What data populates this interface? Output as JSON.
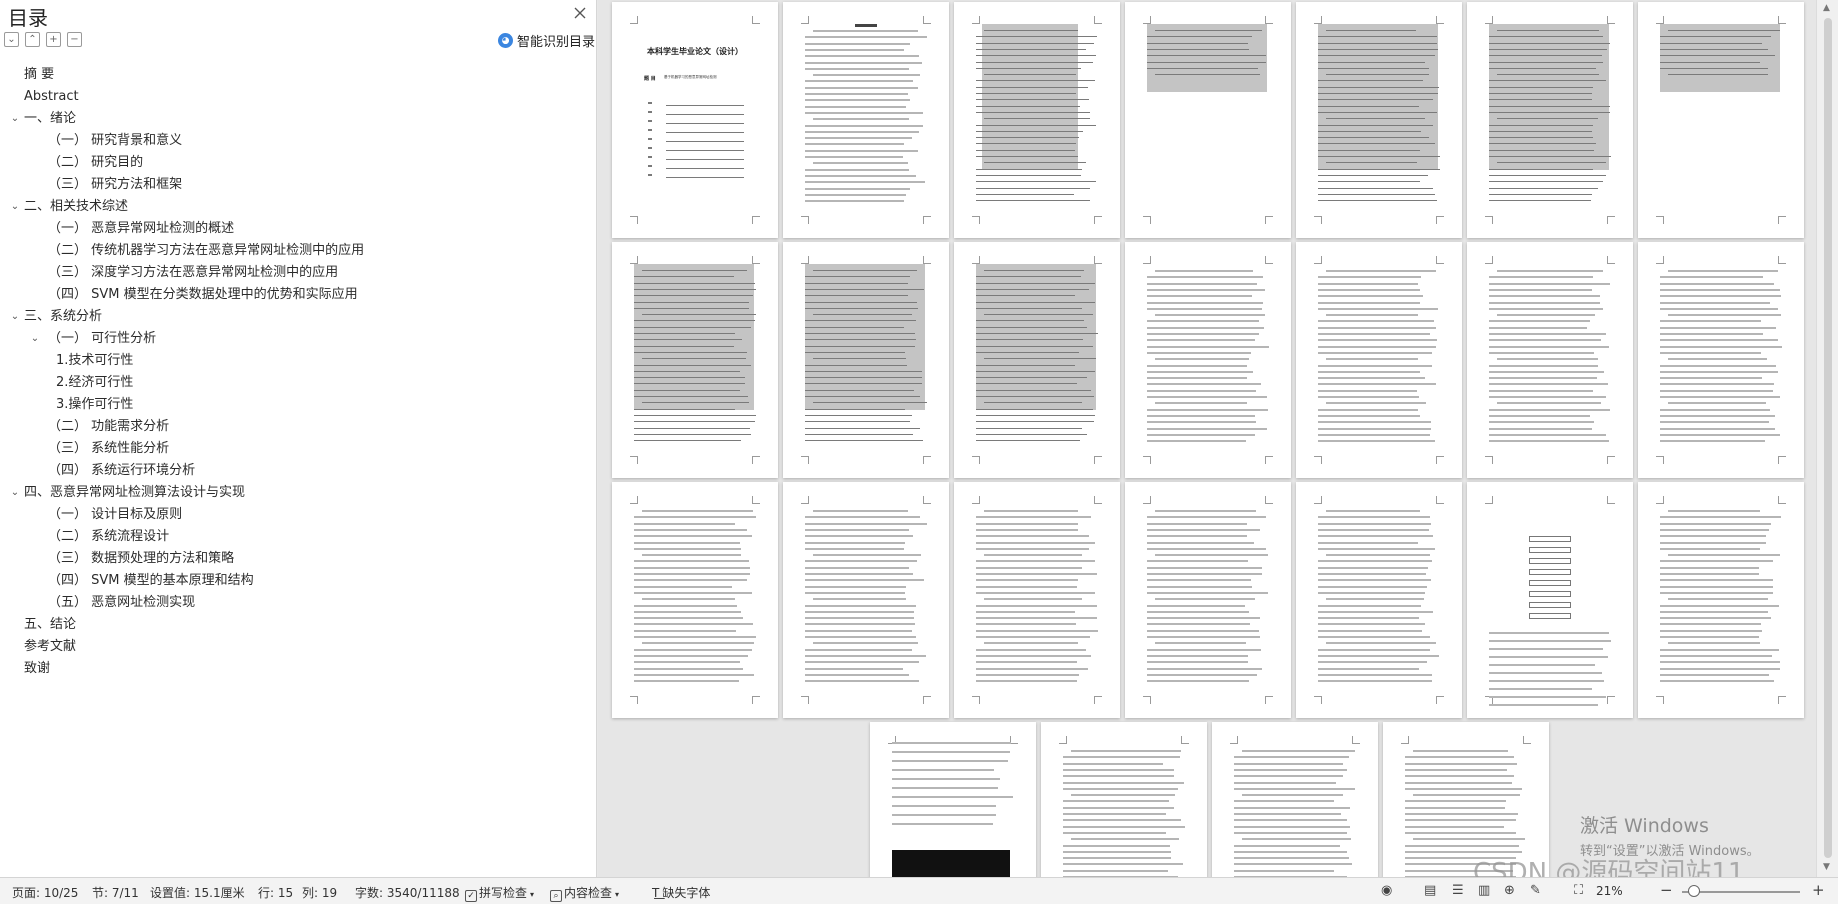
{
  "toc": {
    "title": "目录",
    "smart_toc_label": "智能识别目录",
    "items": [
      {
        "label": "摘 要",
        "level": 0,
        "caret": ""
      },
      {
        "label": "Abstract",
        "level": 0,
        "caret": ""
      },
      {
        "label": "一、绪论",
        "level": 0,
        "caret": "expanded"
      },
      {
        "label": "（一） 研究背景和意义",
        "level": 1,
        "caret": ""
      },
      {
        "label": "（二） 研究目的",
        "level": 1,
        "caret": ""
      },
      {
        "label": "（三） 研究方法和框架",
        "level": 1,
        "caret": ""
      },
      {
        "label": "二、相关技术综述",
        "level": 0,
        "caret": "expanded"
      },
      {
        "label": "（一） 恶意异常网址检测的概述",
        "level": 1,
        "caret": ""
      },
      {
        "label": "（二） 传统机器学习方法在恶意异常网址检测中的应用",
        "level": 1,
        "caret": ""
      },
      {
        "label": "（三） 深度学习方法在恶意异常网址检测中的应用",
        "level": 1,
        "caret": ""
      },
      {
        "label": "（四） SVM 模型在分类数据处理中的优势和实际应用",
        "level": 1,
        "caret": ""
      },
      {
        "label": "三、系统分析",
        "level": 0,
        "caret": "expanded"
      },
      {
        "label": "（一） 可行性分析",
        "level": 1,
        "caret": "expanded"
      },
      {
        "label": "1.技术可行性",
        "level": 2,
        "caret": ""
      },
      {
        "label": "2.经济可行性",
        "level": 2,
        "caret": ""
      },
      {
        "label": "3.操作可行性",
        "level": 2,
        "caret": ""
      },
      {
        "label": "（二） 功能需求分析",
        "level": 1,
        "caret": ""
      },
      {
        "label": "（三） 系统性能分析",
        "level": 1,
        "caret": ""
      },
      {
        "label": "（四） 系统运行环境分析",
        "level": 1,
        "caret": ""
      },
      {
        "label": "四、恶意异常网址检测算法设计与实现",
        "level": 0,
        "caret": "expanded"
      },
      {
        "label": "（一） 设计目标及原则",
        "level": 1,
        "caret": ""
      },
      {
        "label": "（二） 系统流程设计",
        "level": 1,
        "caret": ""
      },
      {
        "label": "（三） 数据预处理的方法和策略",
        "level": 1,
        "caret": ""
      },
      {
        "label": "（四） SVM 模型的基本原理和结构",
        "level": 1,
        "caret": ""
      },
      {
        "label": "（五） 恶意网址检测实现",
        "level": 1,
        "caret": ""
      },
      {
        "label": "五、结论",
        "level": 0,
        "caret": ""
      },
      {
        "label": "参考文献",
        "level": 0,
        "caret": ""
      },
      {
        "label": "致谢",
        "level": 0,
        "caret": ""
      }
    ]
  },
  "document": {
    "cover_title": "本科学生毕业论文（设计）",
    "cover_label": "题 目",
    "cover_subtitle": "基于机器学习的恶意异常网址检测"
  },
  "watermark": {
    "title": "激活 Windows",
    "subtitle": "转到“设置”以激活 Windows。",
    "csdn": "CSDN @源码空间站11"
  },
  "statusbar": {
    "page": "页面: 10/25",
    "section": "节: 7/11",
    "setting": "设置值: 15.1厘米",
    "row": "行: 15",
    "col": "列: 19",
    "words": "字数: 3540/11188",
    "spellcheck": "拼写检查",
    "content_check": "内容检查",
    "missing_font": "缺失字体",
    "zoom": "21%"
  },
  "colors": {
    "accent": "#3b86e0",
    "panel_bg": "#ffffff",
    "canvas_bg": "#e6e6e6",
    "highlight": "#c4c4c4"
  }
}
